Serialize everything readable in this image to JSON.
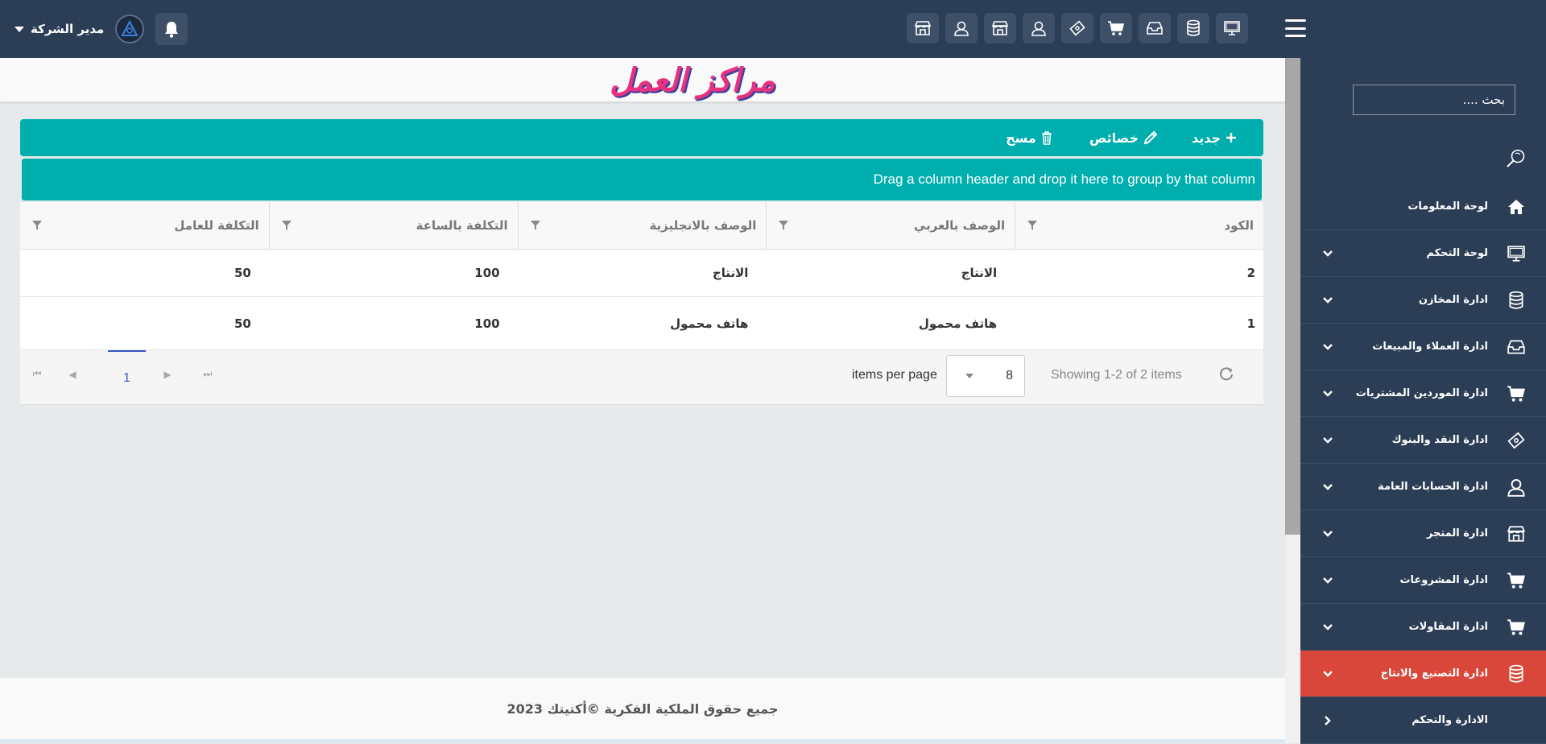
{
  "header": {
    "user_label": "مدير الشركة",
    "top_icons": [
      "monitor-icon",
      "database-icon",
      "inbox-icon",
      "cart-icon",
      "money-icon",
      "user-icon",
      "store-icon",
      "user-icon",
      "store-icon"
    ]
  },
  "sidebar": {
    "search_placeholder": "بحث ....",
    "items": [
      {
        "label": "لوحة المعلومات",
        "icon": "home-icon",
        "chevron": "none",
        "active": false
      },
      {
        "label": "لوحة التحكم",
        "icon": "monitor-icon",
        "chevron": "down",
        "active": false
      },
      {
        "label": "ادارة المخازن",
        "icon": "database-icon",
        "chevron": "down",
        "active": false
      },
      {
        "label": "ادارة العملاء والمبيعات",
        "icon": "inbox-icon",
        "chevron": "down",
        "active": false
      },
      {
        "label": "ادارة الموردين المشتريات",
        "icon": "cart-icon",
        "chevron": "down",
        "active": false
      },
      {
        "label": "ادارة النقد والبنوك",
        "icon": "money-icon",
        "chevron": "down",
        "active": false
      },
      {
        "label": "ادارة الحسابات العامة",
        "icon": "user-icon",
        "chevron": "down",
        "active": false
      },
      {
        "label": "ادارة المتجر",
        "icon": "store-icon",
        "chevron": "down",
        "active": false
      },
      {
        "label": "ادارة المشروعات",
        "icon": "cart-icon",
        "chevron": "down",
        "active": false
      },
      {
        "label": "ادارة المقاولات",
        "icon": "cart-icon",
        "chevron": "down",
        "active": false
      },
      {
        "label": "ادارة التصنيع والانتاج",
        "icon": "database-icon",
        "chevron": "down",
        "active": true
      },
      {
        "label": "الادارة والتحكم",
        "icon": "",
        "chevron": "left",
        "active": false
      }
    ],
    "colors": {
      "background": "#2c3e55",
      "active": "#d9473a"
    }
  },
  "page": {
    "title": "مراكز العمل"
  },
  "toolbar": {
    "new_label": "جديد",
    "edit_label": "خصائص",
    "delete_label": "مسح",
    "color": "#00aeae"
  },
  "grid": {
    "group_hint": "Drag a column header and drop it here to group by that column",
    "columns": [
      "الكود",
      "الوصف بالعربي",
      "الوصف بالانجليزية",
      "التكلفة بالساعة",
      "التكلفة للعامل"
    ],
    "rows": [
      [
        "2",
        "الانتاج",
        "الانتاج",
        "100",
        "50"
      ],
      [
        "1",
        "هاتف محمول",
        "هاتف محمول",
        "100",
        "50"
      ]
    ]
  },
  "pager": {
    "current_page": "1",
    "items_per_page_label": "items per page",
    "page_size": "8",
    "showing_text": "Showing 1-2 of 2 items"
  },
  "footer": {
    "copyright": "جميع حقوق الملكية الفكرية ©أكتيتك 2023"
  }
}
